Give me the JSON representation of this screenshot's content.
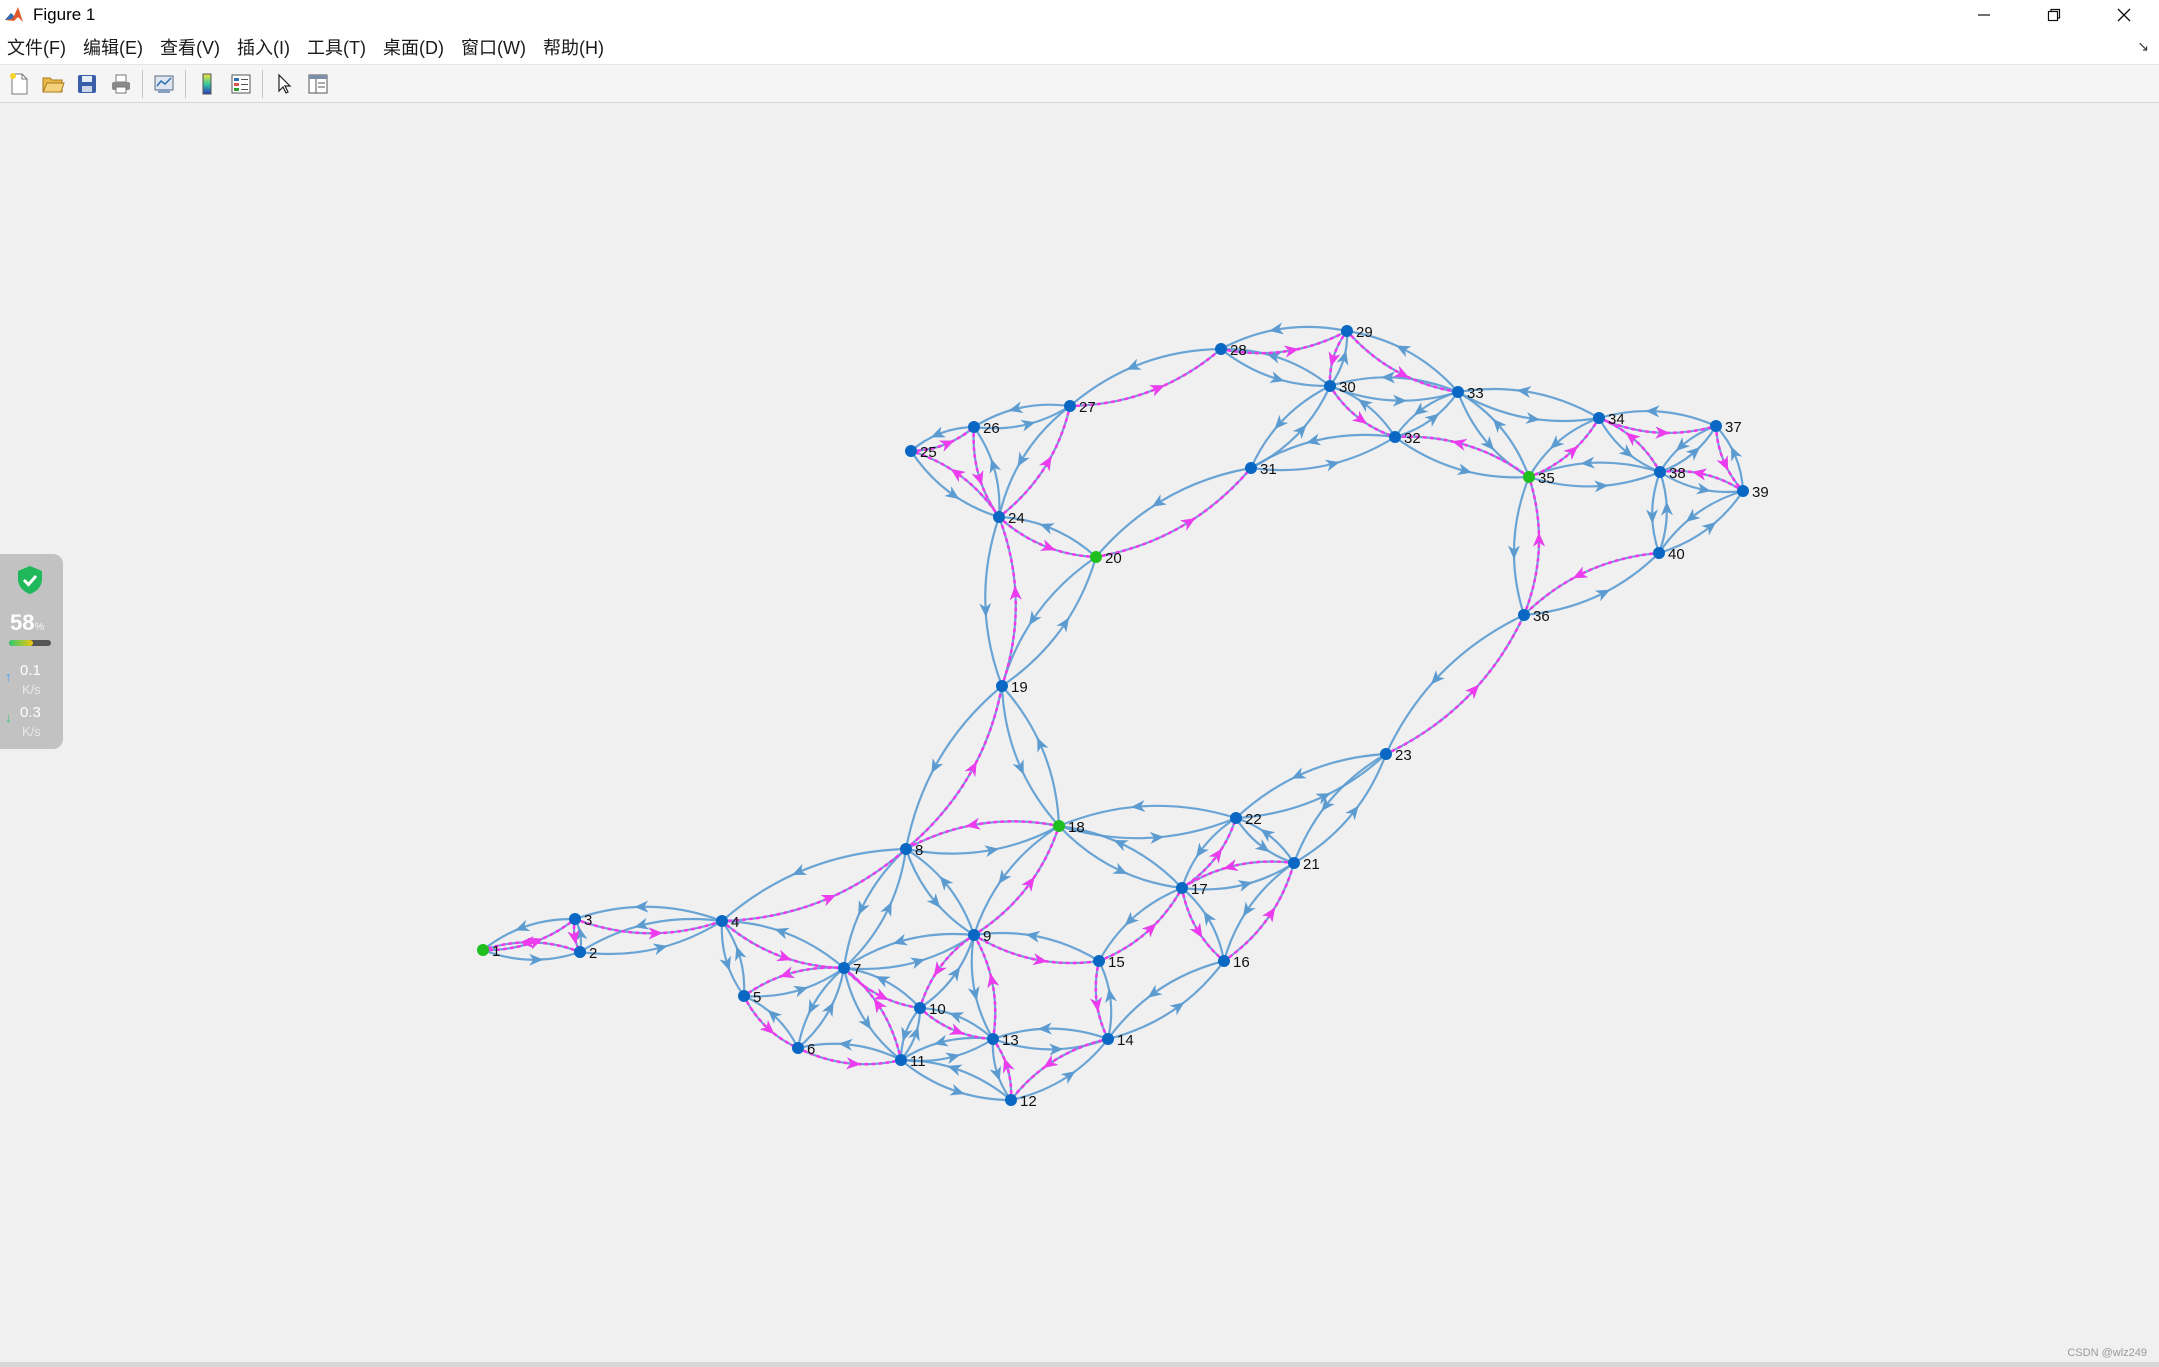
{
  "window": {
    "title": "Figure 1",
    "controls": [
      "minimize",
      "restore",
      "close"
    ]
  },
  "menubar": {
    "items": [
      "文件(F)",
      "编辑(E)",
      "查看(V)",
      "插入(I)",
      "工具(T)",
      "桌面(D)",
      "窗口(W)",
      "帮助(H)"
    ],
    "dock_arrow": "↘"
  },
  "toolbar": {
    "buttons": [
      {
        "name": "new-figure-icon"
      },
      {
        "name": "open-file-icon"
      },
      {
        "name": "save-icon"
      },
      {
        "name": "print-icon"
      },
      {
        "name": "link-plot-icon"
      },
      {
        "name": "colorbar-icon"
      },
      {
        "name": "legend-icon"
      },
      {
        "name": "edit-plot-pointer-icon"
      },
      {
        "name": "property-inspector-icon"
      }
    ]
  },
  "net_widget": {
    "percent": "58",
    "percent_unit": "%",
    "upload_rate": "0.1",
    "upload_unit": "K/s",
    "download_rate": "0.3",
    "download_unit": "K/s",
    "usage_fraction": 0.58
  },
  "watermark": "CSDN @wlz249",
  "colors": {
    "edge": "#5b9bd0",
    "path": "#ee3bee",
    "node": "#0a68c4",
    "highlight_node": "#1fbf1f"
  },
  "graph": {
    "nodes": [
      {
        "id": 1,
        "label": "1",
        "highlight": true
      },
      {
        "id": 2,
        "label": "2"
      },
      {
        "id": 3,
        "label": "3"
      },
      {
        "id": 4,
        "label": "4"
      },
      {
        "id": 5,
        "label": "5"
      },
      {
        "id": 6,
        "label": "6"
      },
      {
        "id": 7,
        "label": "7"
      },
      {
        "id": 8,
        "label": "8"
      },
      {
        "id": 9,
        "label": "9"
      },
      {
        "id": 10,
        "label": "10"
      },
      {
        "id": 11,
        "label": "11"
      },
      {
        "id": 12,
        "label": "12"
      },
      {
        "id": 13,
        "label": "13"
      },
      {
        "id": 14,
        "label": "14"
      },
      {
        "id": 15,
        "label": "15"
      },
      {
        "id": 16,
        "label": "16"
      },
      {
        "id": 17,
        "label": "17"
      },
      {
        "id": 18,
        "label": "18",
        "highlight": true
      },
      {
        "id": 19,
        "label": "19"
      },
      {
        "id": 20,
        "label": "20",
        "highlight": true
      },
      {
        "id": 21,
        "label": "21"
      },
      {
        "id": 22,
        "label": "22"
      },
      {
        "id": 23,
        "label": "23"
      },
      {
        "id": 24,
        "label": "24"
      },
      {
        "id": 25,
        "label": "25"
      },
      {
        "id": 26,
        "label": "26"
      },
      {
        "id": 27,
        "label": "27"
      },
      {
        "id": 28,
        "label": "28"
      },
      {
        "id": 29,
        "label": "29"
      },
      {
        "id": 30,
        "label": "30"
      },
      {
        "id": 31,
        "label": "31"
      },
      {
        "id": 32,
        "label": "32"
      },
      {
        "id": 33,
        "label": "33"
      },
      {
        "id": 34,
        "label": "34"
      },
      {
        "id": 35,
        "label": "35",
        "highlight": true
      },
      {
        "id": 36,
        "label": "36"
      },
      {
        "id": 37,
        "label": "37"
      },
      {
        "id": 38,
        "label": "38"
      },
      {
        "id": 39,
        "label": "39"
      },
      {
        "id": 40,
        "label": "40"
      }
    ],
    "edges": [
      [
        1,
        2
      ],
      [
        2,
        1
      ],
      [
        1,
        3
      ],
      [
        3,
        1
      ],
      [
        2,
        3
      ],
      [
        3,
        2
      ],
      [
        2,
        4
      ],
      [
        4,
        2
      ],
      [
        3,
        4
      ],
      [
        4,
        3
      ],
      [
        4,
        5
      ],
      [
        5,
        4
      ],
      [
        4,
        7
      ],
      [
        7,
        4
      ],
      [
        4,
        8
      ],
      [
        8,
        4
      ],
      [
        5,
        6
      ],
      [
        6,
        5
      ],
      [
        5,
        7
      ],
      [
        7,
        5
      ],
      [
        6,
        7
      ],
      [
        7,
        6
      ],
      [
        6,
        11
      ],
      [
        11,
        6
      ],
      [
        7,
        8
      ],
      [
        8,
        7
      ],
      [
        7,
        9
      ],
      [
        9,
        7
      ],
      [
        7,
        10
      ],
      [
        10,
        7
      ],
      [
        7,
        11
      ],
      [
        11,
        7
      ],
      [
        8,
        9
      ],
      [
        9,
        8
      ],
      [
        8,
        18
      ],
      [
        18,
        8
      ],
      [
        8,
        19
      ],
      [
        19,
        8
      ],
      [
        9,
        10
      ],
      [
        10,
        9
      ],
      [
        9,
        13
      ],
      [
        13,
        9
      ],
      [
        9,
        15
      ],
      [
        15,
        9
      ],
      [
        9,
        18
      ],
      [
        18,
        9
      ],
      [
        10,
        11
      ],
      [
        11,
        10
      ],
      [
        10,
        13
      ],
      [
        13,
        10
      ],
      [
        11,
        12
      ],
      [
        12,
        11
      ],
      [
        11,
        13
      ],
      [
        13,
        11
      ],
      [
        12,
        13
      ],
      [
        13,
        12
      ],
      [
        12,
        14
      ],
      [
        14,
        12
      ],
      [
        13,
        14
      ],
      [
        14,
        13
      ],
      [
        14,
        15
      ],
      [
        15,
        14
      ],
      [
        14,
        16
      ],
      [
        16,
        14
      ],
      [
        15,
        17
      ],
      [
        17,
        15
      ],
      [
        16,
        17
      ],
      [
        17,
        16
      ],
      [
        16,
        21
      ],
      [
        21,
        16
      ],
      [
        17,
        18
      ],
      [
        18,
        17
      ],
      [
        17,
        21
      ],
      [
        21,
        17
      ],
      [
        17,
        22
      ],
      [
        22,
        17
      ],
      [
        18,
        19
      ],
      [
        19,
        18
      ],
      [
        18,
        22
      ],
      [
        22,
        18
      ],
      [
        19,
        20
      ],
      [
        20,
        19
      ],
      [
        19,
        24
      ],
      [
        24,
        19
      ],
      [
        20,
        24
      ],
      [
        24,
        20
      ],
      [
        20,
        31
      ],
      [
        31,
        20
      ],
      [
        21,
        22
      ],
      [
        22,
        21
      ],
      [
        21,
        23
      ],
      [
        23,
        21
      ],
      [
        22,
        23
      ],
      [
        23,
        22
      ],
      [
        23,
        36
      ],
      [
        36,
        23
      ],
      [
        24,
        25
      ],
      [
        25,
        24
      ],
      [
        24,
        26
      ],
      [
        26,
        24
      ],
      [
        24,
        27
      ],
      [
        27,
        24
      ],
      [
        25,
        26
      ],
      [
        26,
        25
      ],
      [
        26,
        27
      ],
      [
        27,
        26
      ],
      [
        27,
        28
      ],
      [
        28,
        27
      ],
      [
        28,
        29
      ],
      [
        29,
        28
      ],
      [
        28,
        30
      ],
      [
        30,
        28
      ],
      [
        29,
        30
      ],
      [
        30,
        29
      ],
      [
        29,
        33
      ],
      [
        33,
        29
      ],
      [
        30,
        31
      ],
      [
        31,
        30
      ],
      [
        30,
        32
      ],
      [
        32,
        30
      ],
      [
        30,
        33
      ],
      [
        33,
        30
      ],
      [
        31,
        32
      ],
      [
        32,
        31
      ],
      [
        32,
        33
      ],
      [
        33,
        32
      ],
      [
        32,
        35
      ],
      [
        35,
        32
      ],
      [
        33,
        34
      ],
      [
        34,
        33
      ],
      [
        33,
        35
      ],
      [
        35,
        33
      ],
      [
        34,
        35
      ],
      [
        35,
        34
      ],
      [
        34,
        37
      ],
      [
        37,
        34
      ],
      [
        34,
        38
      ],
      [
        38,
        34
      ],
      [
        35,
        36
      ],
      [
        36,
        35
      ],
      [
        35,
        38
      ],
      [
        38,
        35
      ],
      [
        36,
        40
      ],
      [
        40,
        36
      ],
      [
        37,
        38
      ],
      [
        38,
        37
      ],
      [
        37,
        39
      ],
      [
        39,
        37
      ],
      [
        38,
        39
      ],
      [
        39,
        38
      ],
      [
        38,
        40
      ],
      [
        40,
        38
      ],
      [
        39,
        40
      ],
      [
        40,
        39
      ]
    ],
    "path_edges": [
      [
        1,
        3
      ],
      [
        3,
        2
      ],
      [
        2,
        1
      ],
      [
        3,
        4
      ],
      [
        4,
        8
      ],
      [
        4,
        7
      ],
      [
        7,
        5
      ],
      [
        5,
        6
      ],
      [
        6,
        11
      ],
      [
        11,
        7
      ],
      [
        7,
        10
      ],
      [
        9,
        10
      ],
      [
        10,
        13
      ],
      [
        13,
        9
      ],
      [
        9,
        18
      ],
      [
        9,
        15
      ],
      [
        15,
        14
      ],
      [
        14,
        12
      ],
      [
        12,
        13
      ],
      [
        18,
        8
      ],
      [
        8,
        19
      ],
      [
        19,
        24
      ],
      [
        24,
        20
      ],
      [
        24,
        25
      ],
      [
        25,
        26
      ],
      [
        26,
        24
      ],
      [
        24,
        27
      ],
      [
        27,
        28
      ],
      [
        28,
        29
      ],
      [
        29,
        30
      ],
      [
        30,
        32
      ],
      [
        29,
        33
      ],
      [
        20,
        31
      ],
      [
        17,
        16
      ],
      [
        16,
        21
      ],
      [
        21,
        17
      ],
      [
        17,
        22
      ],
      [
        15,
        17
      ],
      [
        23,
        36
      ],
      [
        36,
        35
      ],
      [
        35,
        34
      ],
      [
        34,
        37
      ],
      [
        37,
        39
      ],
      [
        39,
        38
      ],
      [
        38,
        34
      ],
      [
        40,
        36
      ],
      [
        35,
        32
      ]
    ]
  }
}
